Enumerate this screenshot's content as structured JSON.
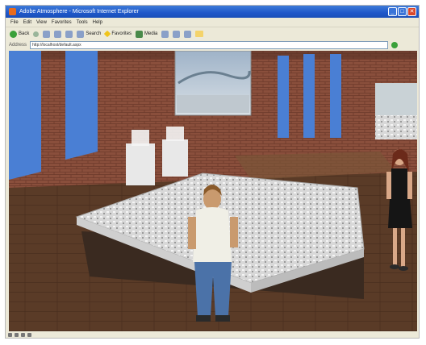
{
  "window": {
    "title": "Adobe Atmosphere - Microsoft Internet Explorer",
    "controls": [
      "_",
      "□",
      "✕"
    ]
  },
  "menu": [
    "File",
    "Edit",
    "View",
    "Favorites",
    "Tools",
    "Help"
  ],
  "toolbar": {
    "back": "Back",
    "search": "Search",
    "favorites": "Favorites",
    "media": "Media"
  },
  "address": {
    "label": "Address",
    "url": "http://localhost/default.aspx",
    "go": "Go"
  },
  "scene": {
    "wall_color": "#8a4f3c",
    "floor_color": "#5a3b27",
    "table_color": "#3a2a20",
    "model_color": "#e6e6e6",
    "banner_color": "#4a7fd4"
  },
  "status_icons": [
    "globe-icon",
    "page-icon",
    "lock-icon",
    "zone-icon"
  ]
}
